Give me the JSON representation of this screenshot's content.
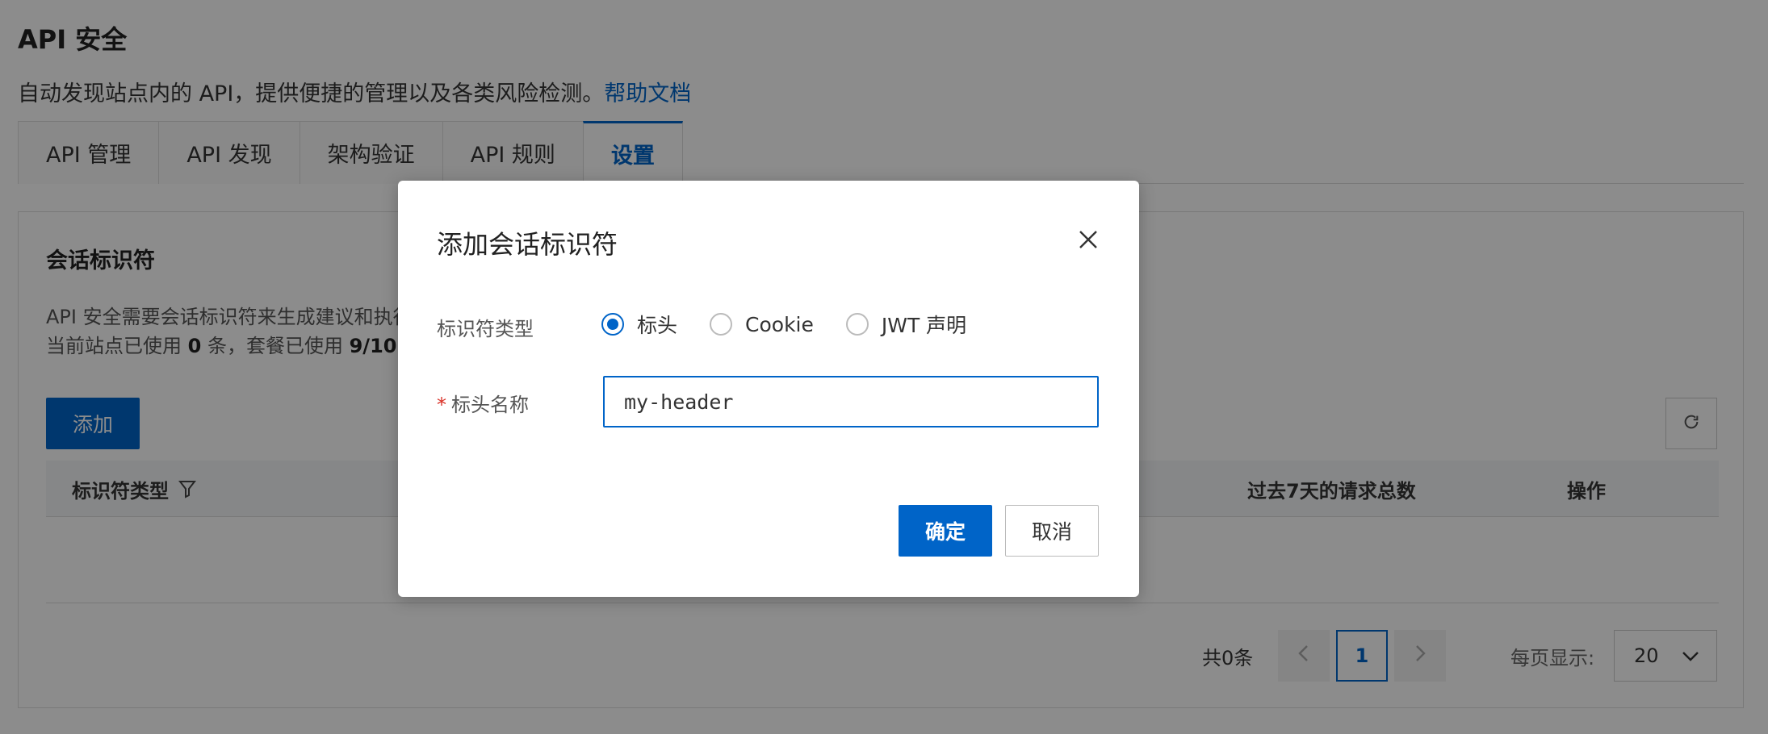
{
  "page": {
    "title": "API 安全",
    "description": "自动发现站点内的 API，提供便捷的管理以及各类风险检测。",
    "help_link": "帮助文档"
  },
  "tabs": [
    {
      "label": "API 管理",
      "active": false
    },
    {
      "label": "API 发现",
      "active": false
    },
    {
      "label": "架构验证",
      "active": false
    },
    {
      "label": "API 规则",
      "active": false
    },
    {
      "label": "设置",
      "active": true
    }
  ],
  "card": {
    "title": "会话标识符",
    "desc_line1": "API 安全需要会话标识符来生成建议和执行",
    "desc_line2_prefix": "当前站点已使用 ",
    "desc_line2_site_count": "0",
    "desc_line2_mid": " 条，套餐已使用 ",
    "desc_line2_plan_count": "9/10",
    "add_button": "添加",
    "table": {
      "col_type": "标识符类型",
      "col_requests": "过去7天的请求总数",
      "col_ops": "操作"
    },
    "pagination": {
      "total": "共0条",
      "current_page": "1",
      "per_page_label": "每页显示:",
      "per_page_value": "20"
    }
  },
  "dialog": {
    "title": "添加会话标识符",
    "type_label": "标识符类型",
    "radio_options": [
      {
        "label": "标头",
        "checked": true
      },
      {
        "label": "Cookie",
        "checked": false
      },
      {
        "label": "JWT 声明",
        "checked": false
      }
    ],
    "name_label": "标头名称",
    "name_value": "my-header",
    "ok_button": "确定",
    "cancel_button": "取消"
  },
  "colors": {
    "primary": "#0064c8",
    "required": "#d93026",
    "mask": "rgba(0,0,0,0.45)"
  },
  "icons": [
    "filter-icon",
    "refresh-icon",
    "close-icon",
    "chevron-left-icon",
    "chevron-right-icon",
    "chevron-down-icon"
  ]
}
